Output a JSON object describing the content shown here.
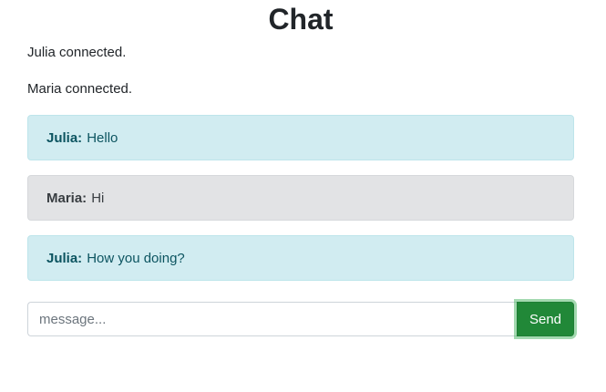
{
  "page": {
    "title": "Chat"
  },
  "status_messages": [
    "Julia connected.",
    "Maria connected."
  ],
  "messages": [
    {
      "author": "Julia:",
      "text": "Hello",
      "style": "info"
    },
    {
      "author": "Maria:",
      "text": "Hi",
      "style": "secondary"
    },
    {
      "author": "Julia:",
      "text": "How you doing?",
      "style": "info"
    }
  ],
  "composer": {
    "placeholder": "message...",
    "value": "",
    "send_label": "Send"
  },
  "colors": {
    "info_bg": "#d1ecf1",
    "info_text": "#0c5460",
    "secondary_bg": "#e2e3e5",
    "secondary_text": "#383d41",
    "send_button": "#218838"
  }
}
